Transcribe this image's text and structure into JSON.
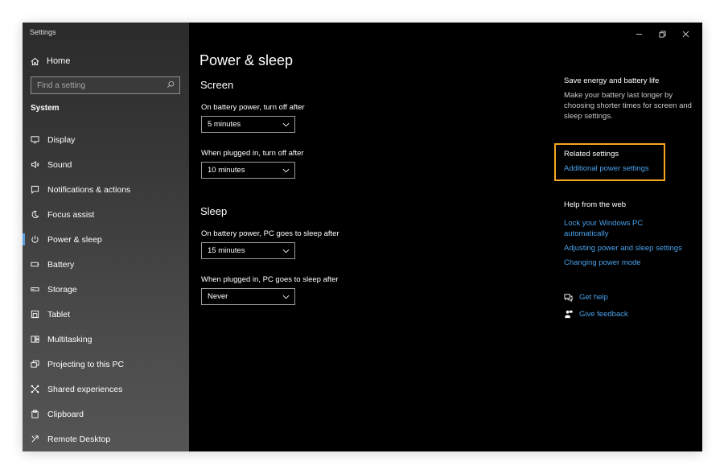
{
  "app": {
    "title": "Settings"
  },
  "sidebar": {
    "home_label": "Home",
    "search_placeholder": "Find a setting",
    "section_label": "System",
    "items": [
      {
        "label": "Display",
        "icon": "monitor-icon"
      },
      {
        "label": "Sound",
        "icon": "speaker-icon"
      },
      {
        "label": "Notifications & actions",
        "icon": "notification-icon"
      },
      {
        "label": "Focus assist",
        "icon": "moon-icon"
      },
      {
        "label": "Power & sleep",
        "icon": "power-icon",
        "active": true
      },
      {
        "label": "Battery",
        "icon": "battery-icon"
      },
      {
        "label": "Storage",
        "icon": "storage-icon"
      },
      {
        "label": "Tablet",
        "icon": "tablet-icon"
      },
      {
        "label": "Multitasking",
        "icon": "multitasking-icon"
      },
      {
        "label": "Projecting to this PC",
        "icon": "projecting-icon"
      },
      {
        "label": "Shared experiences",
        "icon": "shared-icon"
      },
      {
        "label": "Clipboard",
        "icon": "clipboard-icon"
      },
      {
        "label": "Remote Desktop",
        "icon": "remote-desktop-icon"
      }
    ]
  },
  "main": {
    "title": "Power & sleep",
    "screen": {
      "title": "Screen",
      "battery_label": "On battery power, turn off after",
      "battery_value": "5 minutes",
      "plugged_label": "When plugged in, turn off after",
      "plugged_value": "10 minutes"
    },
    "sleep": {
      "title": "Sleep",
      "battery_label": "On battery power, PC goes to sleep after",
      "battery_value": "15 minutes",
      "plugged_label": "When plugged in, PC goes to sleep after",
      "plugged_value": "Never"
    }
  },
  "right": {
    "save_energy_heading": "Save energy and battery life",
    "save_energy_text": "Make your battery last longer by choosing shorter times for screen and sleep settings.",
    "related_heading": "Related settings",
    "related_link": "Additional power settings",
    "help_heading": "Help from the web",
    "help_links": [
      "Lock your Windows PC automatically",
      "Adjusting power and sleep settings",
      "Changing power mode"
    ],
    "get_help": "Get help",
    "give_feedback": "Give feedback"
  },
  "colors": {
    "accent_link": "#4aa0ea",
    "highlight_box": "#f5a623",
    "main_background": "#000000"
  }
}
